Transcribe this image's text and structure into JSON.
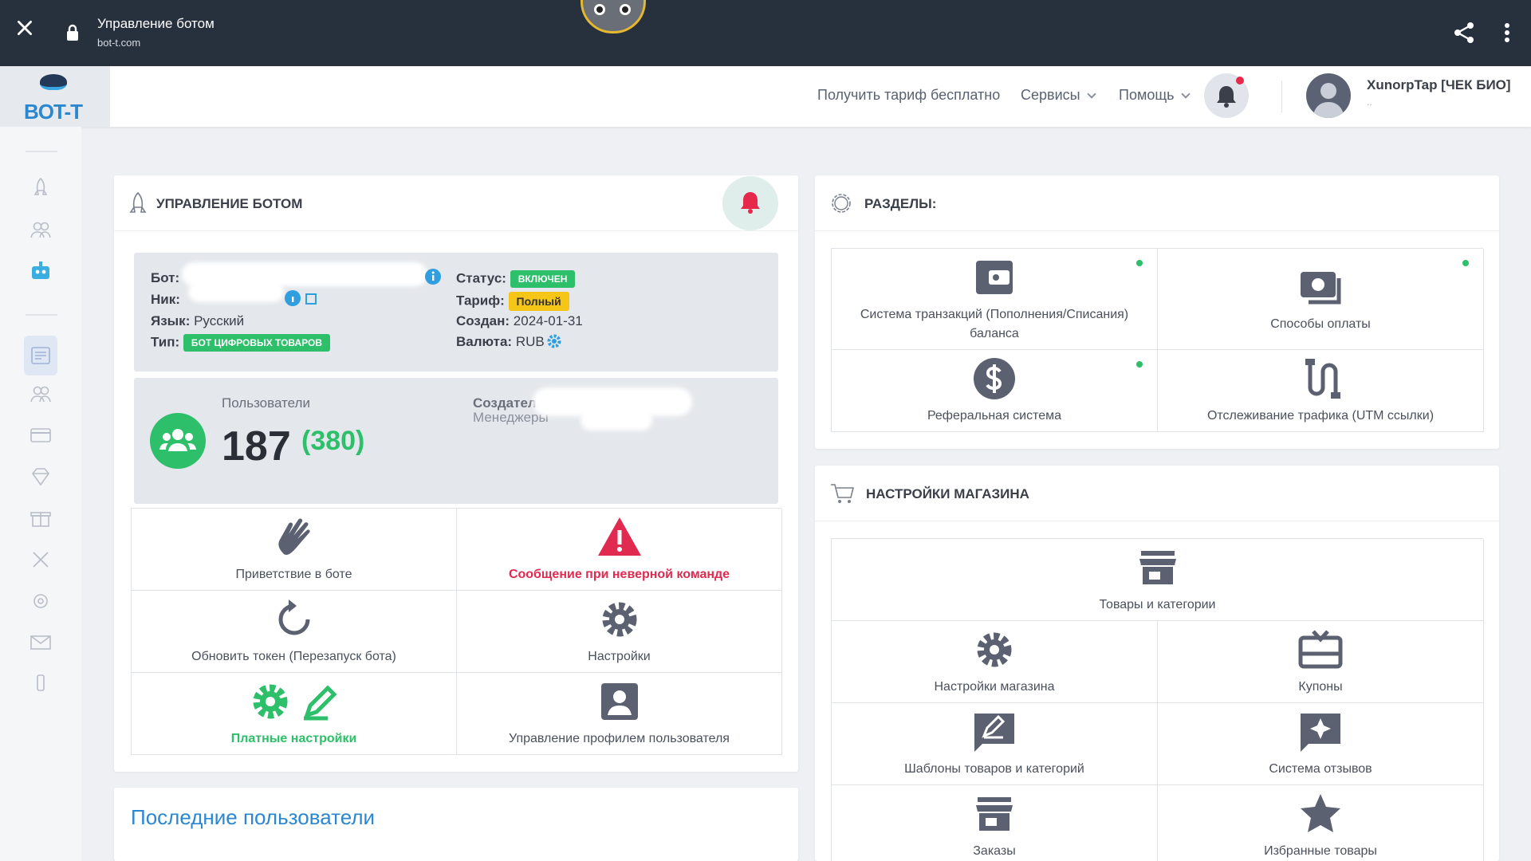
{
  "browser": {
    "title": "Управление ботом",
    "url": "bot-t.com"
  },
  "header": {
    "logo": "BOT-T",
    "nav": {
      "free_tariff": "Получить тариф бесплатно",
      "services": "Сервисы",
      "help": "Помощь"
    },
    "user": {
      "name": "XunorpTap [ЧЕК БИО]",
      "sub": ".."
    }
  },
  "bot_card": {
    "title": "УПРАВЛЕНИЕ БОТОМ",
    "info": {
      "bot_label": "Бот:",
      "nick_label": "Ник:",
      "lang_label": "Язык:",
      "lang_value": "Русский",
      "type_label": "Тип:",
      "type_value": "БОТ ЦИФРОВЫХ ТОВАРОВ",
      "status_label": "Статус:",
      "status_value": "ВКЛЮЧЕН",
      "tariff_label": "Тариф:",
      "tariff_value": "Полный",
      "created_label": "Создан:",
      "created_value": "2024-01-31",
      "currency_label": "Валюта:",
      "currency_value": "RUB"
    },
    "stats": {
      "users_label": "Пользователи",
      "users_count": "187",
      "users_total": "(380)",
      "creator_label": "Создатель",
      "managers_label": "Менеджеры"
    },
    "actions": [
      {
        "label": "Приветствие в боте",
        "icon": "waving-hand-icon"
      },
      {
        "label": "Сообщение при неверной команде",
        "icon": "warning-icon"
      },
      {
        "label": "Обновить токен (Перезапуск бота)",
        "icon": "refresh-icon"
      },
      {
        "label": "Настройки",
        "icon": "gear-icon"
      },
      {
        "label": "Платные настройки",
        "icon": "paid-settings-icon"
      },
      {
        "label": "Управление профилем пользователя",
        "icon": "user-profile-icon"
      }
    ]
  },
  "recent_users": {
    "title": "Последние пользователи"
  },
  "sections_card": {
    "title": "РАЗДЕЛЫ:",
    "items": [
      {
        "label": "Система транзакций (Пополнения/Списания) баланса",
        "icon": "wallet-icon"
      },
      {
        "label": "Способы оплаты",
        "icon": "money-icon"
      },
      {
        "label": "Реферальная система",
        "icon": "dollar-icon"
      },
      {
        "label": "Отслеживание трафика (UTM ссылки)",
        "icon": "route-icon"
      }
    ]
  },
  "shop_card": {
    "title": "НАСТРОЙКИ МАГАЗИНА",
    "items": [
      {
        "label": "Товары и категории",
        "icon": "store-icon"
      },
      {
        "label": "Настройки магазина",
        "icon": "gear-icon"
      },
      {
        "label": "Купоны",
        "icon": "gift-card-icon"
      },
      {
        "label": "Шаблоны товаров и категорий",
        "icon": "template-icon"
      },
      {
        "label": "Система отзывов",
        "icon": "review-icon"
      },
      {
        "label": "Заказы",
        "icon": "store-icon"
      },
      {
        "label": "Избранные товары",
        "icon": "star-icon"
      }
    ]
  },
  "colors": {
    "accent": "#2a87d0",
    "success": "#2ebf6a",
    "danger": "#e02a50",
    "topbar": "#27303d"
  }
}
